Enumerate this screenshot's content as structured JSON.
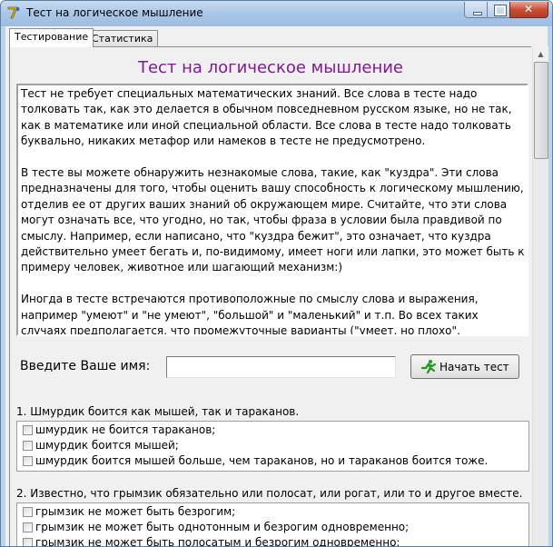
{
  "window": {
    "title": "Тест на логическое мышление"
  },
  "tabs": [
    {
      "label": "Тестирование"
    },
    {
      "label": "Статистика"
    }
  ],
  "main": {
    "heading": "Тест на логическое мышление",
    "heading_color": "#7f1a94",
    "intro": [
      "Тест не требует специальных математических знаний. Все слова в тесте надо толковать так, как это делается в обычном повседневном русском языке, но не так, как в математике или иной специальной области. Все слова в тесте надо толковать буквально, никаких метафор или намеков в тесте не предусмотрено.",
      "В тесте вы можете обнаружить незнакомые слова, такие, как \"куздра\". Эти слова предназначены для того, чтобы оценить вашу способность к логическому мышлению, отделив ее от других ваших знаний об окружающем мире. Считайте, что эти слова могут означать все, что угодно, но так, чтобы фраза в условии была правдивой по смыслу. Например, если написано, что \"куздра бежит\", это означает, что куздра действительно умеет бегать и, по-видимому, имеет ноги или лапки, это может быть к примеру человек, животное или шагающий механизм:)",
      "Иногда в тесте встречаются противоположные по смыслу слова и выражения, например \"умеют\" и \"не умеют\", \"большой\" и \"маленький\" и т.п. Во всех таких случаях предполагается, что промежуточные варианты (\"умеет, но плохо\", \"средний\") не рассматриваются."
    ],
    "name_label": "Введите Ваше имя:",
    "name_value": "",
    "start_button": "Начать тест"
  },
  "questions": [
    {
      "text": "1. Шмурдик боится как мышей, так и тараканов.",
      "options": [
        {
          "label": "шмурдик не боится тараканов;",
          "checked": false
        },
        {
          "label": "шмурдик боится мышей;",
          "checked": false
        },
        {
          "label": "шмурдик боится мышей больше, чем тараканов, но и тараканов боится тоже.",
          "checked": false
        }
      ]
    },
    {
      "text": "2. Известно, что грымзик обязательно или полосат, или рогат, или то и другое вместе.",
      "options": [
        {
          "label": "грымзик не может быть безрогим;",
          "checked": false
        },
        {
          "label": "грымзик не может быть однотонным и безрогим одновременно;",
          "checked": false
        },
        {
          "label": "грымзик не может быть полосатым и безрогим одновременно;",
          "checked": false
        }
      ]
    }
  ]
}
